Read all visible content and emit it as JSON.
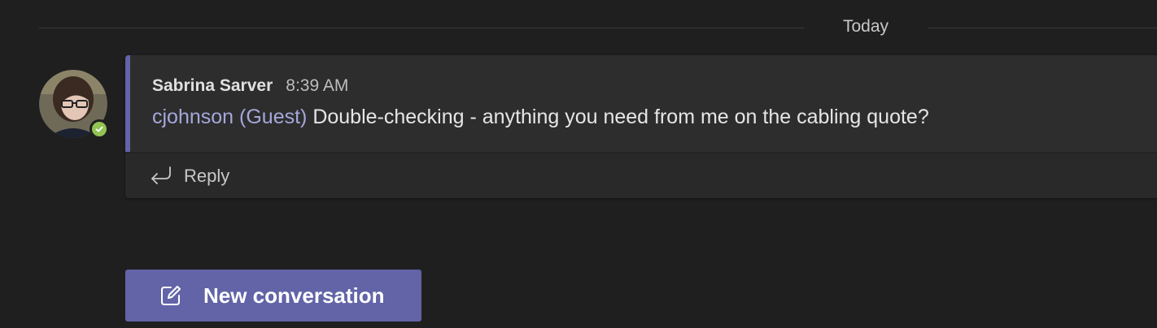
{
  "divider": {
    "label": "Today"
  },
  "message": {
    "author": "Sabrina Sarver",
    "time": "8:39 AM",
    "mention": "cjohnson (Guest)",
    "text": " Double-checking - anything you need from me on the cabling quote?",
    "presence": "available",
    "reply_label": "Reply"
  },
  "composer": {
    "new_conversation_label": "New conversation"
  },
  "icons": {
    "reply": "reply-arrow-icon",
    "compose": "compose-icon",
    "presence": "checkmark-icon"
  },
  "colors": {
    "background": "#1f1f1f",
    "card": "#2d2d2d",
    "accent": "#6264a7",
    "mention": "#a6a7dc",
    "presence": "#92c353"
  }
}
